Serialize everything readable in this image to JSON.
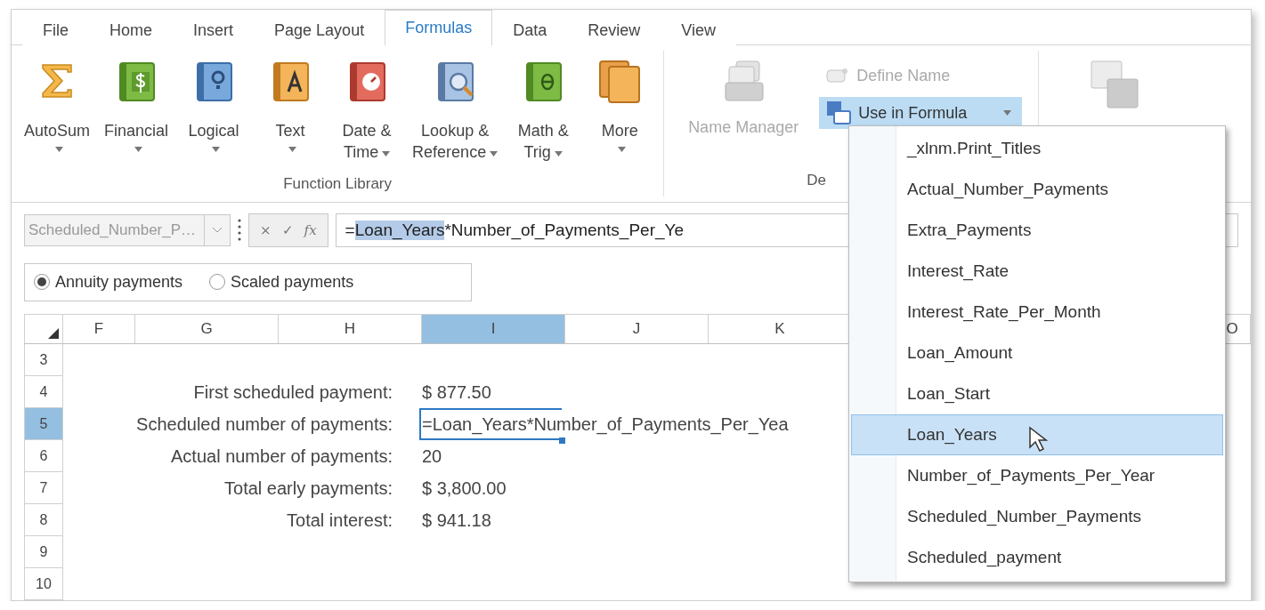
{
  "tabs": [
    {
      "label": "File",
      "selected": false
    },
    {
      "label": "Home",
      "selected": false
    },
    {
      "label": "Insert",
      "selected": false
    },
    {
      "label": "Page Layout",
      "selected": false
    },
    {
      "label": "Formulas",
      "selected": true
    },
    {
      "label": "Data",
      "selected": false
    },
    {
      "label": "Review",
      "selected": false
    },
    {
      "label": "View",
      "selected": false
    }
  ],
  "ribbon": {
    "function_library": {
      "label": "Function Library",
      "buttons": [
        {
          "kind": "sigma",
          "lines": [
            "AutoSum"
          ]
        },
        {
          "kind": "financial",
          "lines": [
            "Financial"
          ]
        },
        {
          "kind": "logical",
          "lines": [
            "Logical"
          ]
        },
        {
          "kind": "text",
          "lines": [
            "Text"
          ]
        },
        {
          "kind": "datetime",
          "lines": [
            "Date &",
            "Time"
          ]
        },
        {
          "kind": "lookup",
          "lines": [
            "Lookup &",
            "Reference"
          ]
        },
        {
          "kind": "math",
          "lines": [
            "Math &",
            "Trig"
          ]
        },
        {
          "kind": "more",
          "lines": [
            "More"
          ]
        }
      ]
    },
    "defined_names": {
      "label": "De",
      "name_manager": {
        "label": "Name Manager",
        "disabled": true
      },
      "define_name": {
        "label": "Define Name",
        "disabled": true
      },
      "use_in_formula": {
        "label": "Use in Formula",
        "pressed": true
      }
    },
    "show_formulas": {
      "disabled": true
    }
  },
  "formula_bar": {
    "name_box": "Scheduled_Number_P…",
    "buttons": [
      "×",
      "✓",
      "fx"
    ],
    "formula": {
      "before": "=",
      "highlight": "Loan_Years",
      "after": "*Number_of_Payments_Per_Ye"
    }
  },
  "radios": [
    {
      "label": "Annuity payments",
      "selected": true
    },
    {
      "label": "Scaled payments",
      "selected": false
    }
  ],
  "grid": {
    "columns": [
      {
        "label": "F",
        "selected": false
      },
      {
        "label": "G",
        "selected": false
      },
      {
        "label": "H",
        "selected": false
      },
      {
        "label": "I",
        "selected": true
      },
      {
        "label": "J",
        "selected": false
      },
      {
        "label": "K",
        "selected": false
      },
      {
        "label": "O",
        "selected": false
      }
    ],
    "rows": [
      {
        "number": "3",
        "selected": false
      },
      {
        "number": "4",
        "selected": false,
        "label": "First scheduled payment:",
        "value": "$ 877.50"
      },
      {
        "number": "5",
        "selected": true,
        "label": "Scheduled number of payments:",
        "value": "=Loan_Years*Number_of_Payments_Per_Yea"
      },
      {
        "number": "6",
        "selected": false,
        "label": "Actual number of payments:",
        "value": "20"
      },
      {
        "number": "7",
        "selected": false,
        "label": "Total early payments:",
        "value": "$ 3,800.00"
      },
      {
        "number": "8",
        "selected": false,
        "label": "Total interest:",
        "value": "$ 941.18"
      },
      {
        "number": "9",
        "selected": false
      },
      {
        "number": "10",
        "selected": false
      }
    ]
  },
  "menu": {
    "items": [
      {
        "label": "_xlnm.Print_Titles",
        "selected": false
      },
      {
        "label": "Actual_Number_Payments",
        "selected": false
      },
      {
        "label": "Extra_Payments",
        "selected": false
      },
      {
        "label": "Interest_Rate",
        "selected": false
      },
      {
        "label": "Interest_Rate_Per_Month",
        "selected": false
      },
      {
        "label": "Loan_Amount",
        "selected": false
      },
      {
        "label": "Loan_Start",
        "selected": false
      },
      {
        "label": "Loan_Years",
        "selected": true
      },
      {
        "label": "Number_of_Payments_Per_Year",
        "selected": false
      },
      {
        "label": "Scheduled_Number_Payments",
        "selected": false
      },
      {
        "label": "Scheduled_payment",
        "selected": false
      }
    ]
  }
}
